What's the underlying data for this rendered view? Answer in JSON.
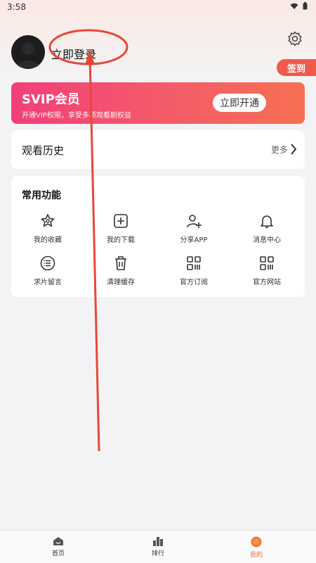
{
  "status_bar": {
    "time": "3:58"
  },
  "profile": {
    "login_text": "立即登录",
    "sign_in_label": "签到"
  },
  "svip": {
    "title": "SVIP会员",
    "description": "开通VIP权限，享受多项观看剧权益",
    "button_label": "立即开通"
  },
  "history": {
    "title": "观看历史",
    "more_label": "更多"
  },
  "functions": {
    "title": "常用功能",
    "items": [
      {
        "label": "我的收藏",
        "icon": "star-icon"
      },
      {
        "label": "我的下载",
        "icon": "download-icon"
      },
      {
        "label": "分享APP",
        "icon": "share-user-icon"
      },
      {
        "label": "消息中心",
        "icon": "bell-icon"
      },
      {
        "label": "求片留言",
        "icon": "list-icon"
      },
      {
        "label": "清理缓存",
        "icon": "trash-icon"
      },
      {
        "label": "官方订阅",
        "icon": "qr-icon"
      },
      {
        "label": "官方网站",
        "icon": "qr-icon"
      }
    ]
  },
  "tabs": [
    {
      "label": "首页",
      "icon": "home-icon"
    },
    {
      "label": "排行",
      "icon": "rank-icon"
    },
    {
      "label": "我的",
      "icon": "profile-icon",
      "active": true
    }
  ],
  "colors": {
    "accent": "#ef5a4c",
    "svip_gradient_start": "#f23e79",
    "svip_gradient_end": "#f76f52",
    "annotation": "#e8463a"
  }
}
